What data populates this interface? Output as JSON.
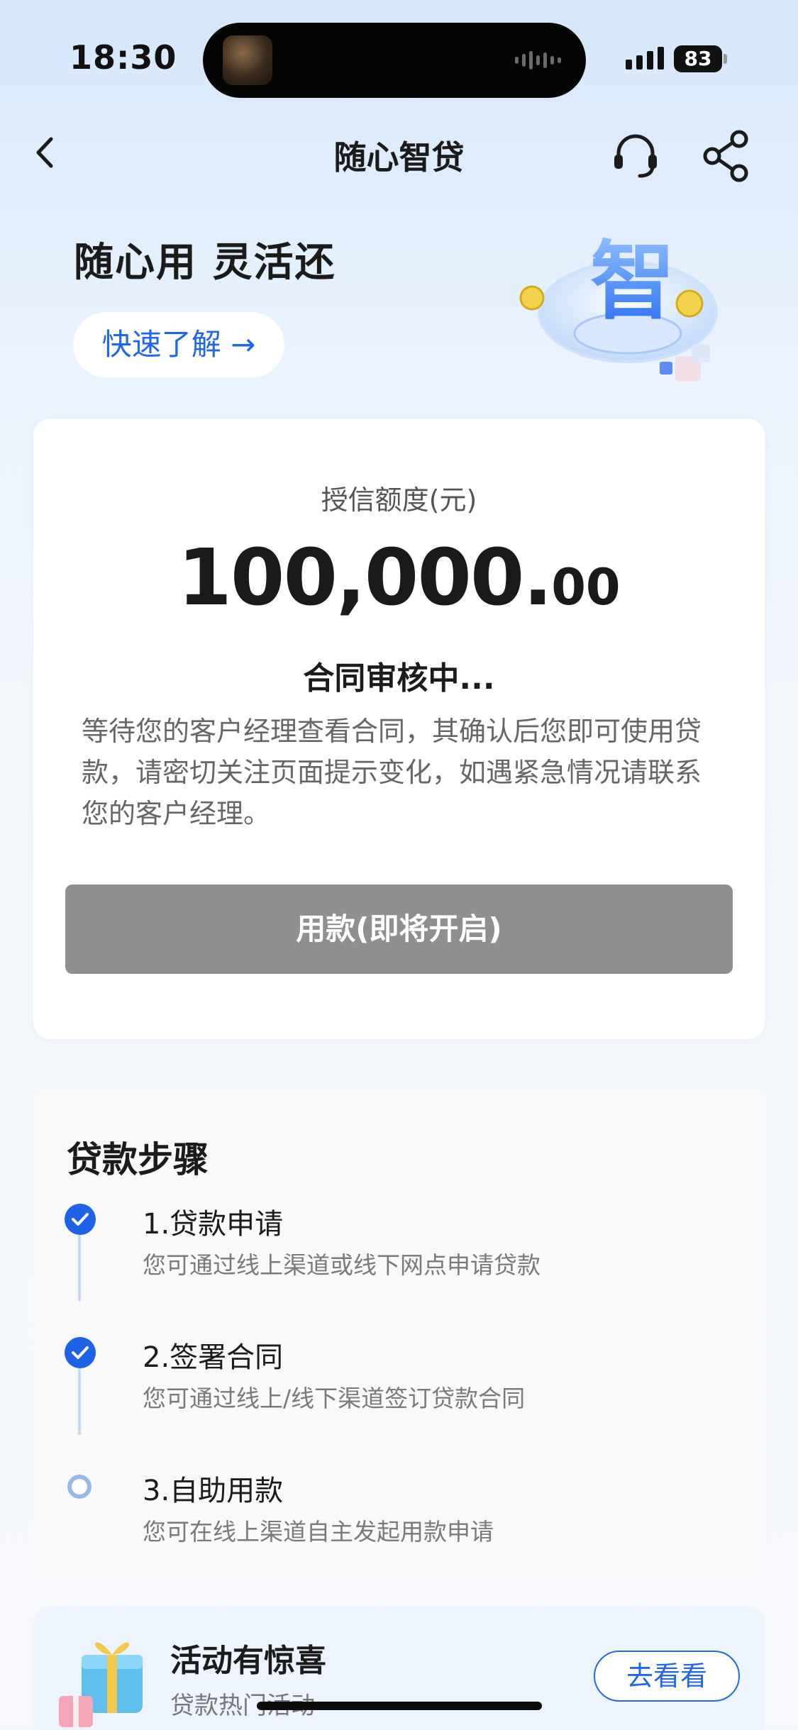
{
  "status_bar": {
    "time": "18:30",
    "battery": "83",
    "island_thumb_icon": "game-app-icon",
    "signal_icon": "cellular-signal-icon"
  },
  "nav": {
    "title": "随心智贷",
    "back_icon": "chevron-left-icon",
    "service_icon": "headset-icon",
    "share_icon": "share-icon"
  },
  "hero": {
    "slogan": "随心用 灵活还",
    "learn_label": "快速了解 →",
    "art_glyph": "智"
  },
  "credit": {
    "label": "授信额度(元)",
    "amount_int": "100,000.",
    "amount_dec": "00",
    "status_title": "合同审核中...",
    "status_desc": "等待您的客户经理查看合同，其确认后您即可使用贷款，请密切关注页面提示变化，如遇紧急情况请联系您的客户经理。",
    "use_button": "用款(即将开启)"
  },
  "steps": {
    "title": "贷款步骤",
    "items": [
      {
        "title": "1.贷款申请",
        "desc": "您可通过线上渠道或线下网点申请贷款",
        "state": "done"
      },
      {
        "title": "2.签署合同",
        "desc": "您可通过线上/线下渠道签订贷款合同",
        "state": "done"
      },
      {
        "title": "3.自助用款",
        "desc": "您可在线上渠道自主发起用款申请",
        "state": "pending"
      }
    ]
  },
  "promo": {
    "title": "活动有惊喜",
    "subtitle": "贷款热门活动",
    "button": "去看看",
    "gift_icon": "gift-box-icon"
  },
  "colors": {
    "accent": "#2266ee",
    "check": "#1d63e8",
    "disabled_button": "#8f8f8f"
  }
}
